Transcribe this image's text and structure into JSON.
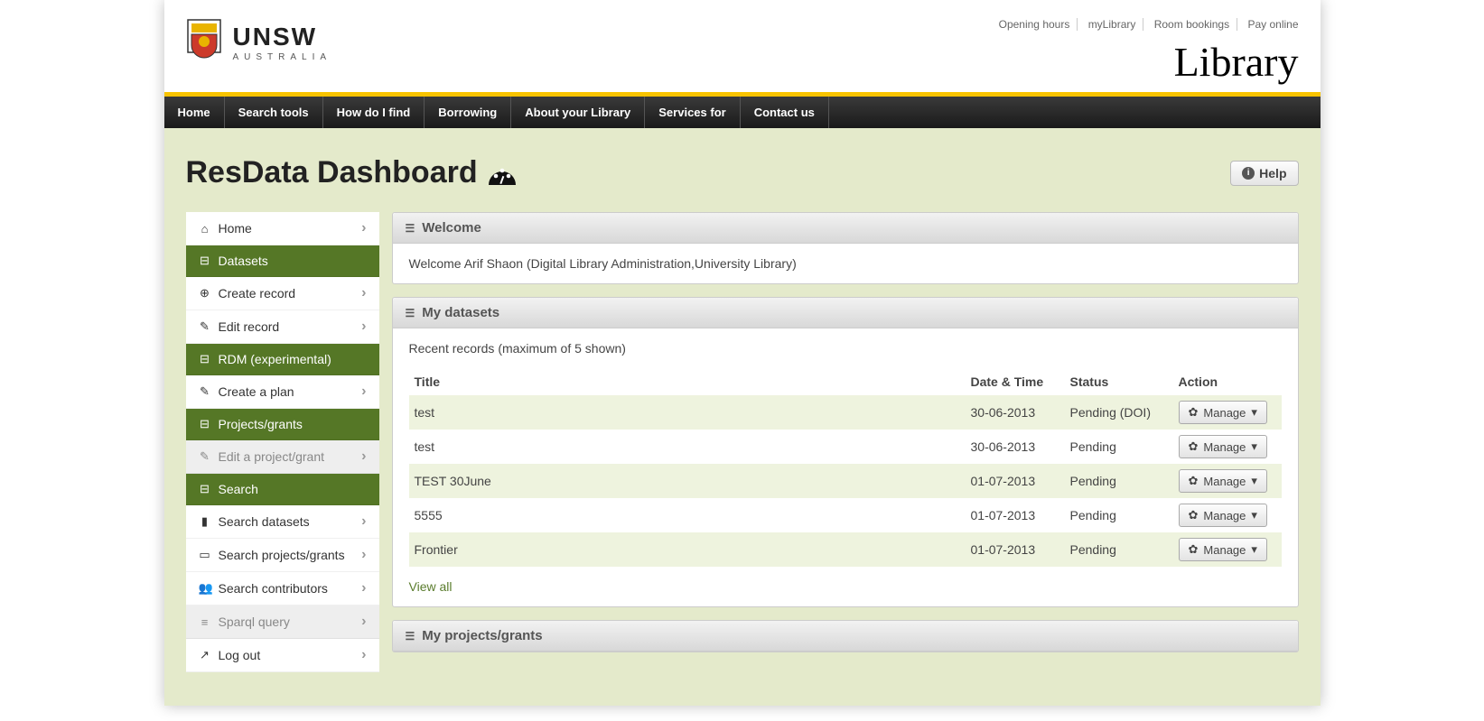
{
  "toplinks": [
    "Opening hours",
    "myLibrary",
    "Room bookings",
    "Pay online"
  ],
  "logo": {
    "unsw": "UNSW",
    "aus": "AUSTRALIA"
  },
  "library_title": "Library",
  "nav": [
    "Home",
    "Search tools",
    "How do I find",
    "Borrowing",
    "About your Library",
    "Services for",
    "Contact us"
  ],
  "page_title": "ResData Dashboard",
  "help_label": "Help",
  "sidebar": [
    {
      "kind": "item",
      "label": "Home",
      "icon": "⌂"
    },
    {
      "kind": "head",
      "label": "Datasets",
      "icon": "⊟"
    },
    {
      "kind": "item",
      "label": "Create record",
      "icon": "⊕"
    },
    {
      "kind": "item",
      "label": "Edit record",
      "icon": "✎"
    },
    {
      "kind": "head",
      "label": "RDM (experimental)",
      "icon": "⊟"
    },
    {
      "kind": "item",
      "label": "Create a plan",
      "icon": "✎"
    },
    {
      "kind": "head",
      "label": "Projects/grants",
      "icon": "⊟"
    },
    {
      "kind": "item",
      "label": "Edit a project/grant",
      "icon": "✎",
      "disabled": true
    },
    {
      "kind": "head",
      "label": "Search",
      "icon": "⊟"
    },
    {
      "kind": "item",
      "label": "Search datasets",
      "icon": "▮"
    },
    {
      "kind": "item",
      "label": "Search projects/grants",
      "icon": "▭"
    },
    {
      "kind": "item",
      "label": "Search contributors",
      "icon": "👥"
    },
    {
      "kind": "item",
      "label": "Sparql query",
      "icon": "≡",
      "disabled": true
    },
    {
      "kind": "item",
      "label": "Log out",
      "icon": "↗"
    }
  ],
  "welcome_head": "Welcome",
  "welcome_text": "Welcome Arif Shaon (Digital Library Administration,University Library)",
  "mydatasets_head": "My datasets",
  "recent_label": "Recent records (maximum of 5 shown)",
  "columns": {
    "title": "Title",
    "date": "Date & Time",
    "status": "Status",
    "action": "Action"
  },
  "manage_label": "Manage",
  "rows": [
    {
      "title": "test",
      "date": "30-06-2013",
      "status": "Pending (DOI)"
    },
    {
      "title": "test",
      "date": "30-06-2013",
      "status": "Pending"
    },
    {
      "title": "TEST 30June",
      "date": "01-07-2013",
      "status": "Pending",
      "link": true
    },
    {
      "title": "5555",
      "date": "01-07-2013",
      "status": "Pending"
    },
    {
      "title": "Frontier",
      "date": "01-07-2013",
      "status": "Pending"
    }
  ],
  "view_all": "View all",
  "myprojects_head": "My projects/grants"
}
